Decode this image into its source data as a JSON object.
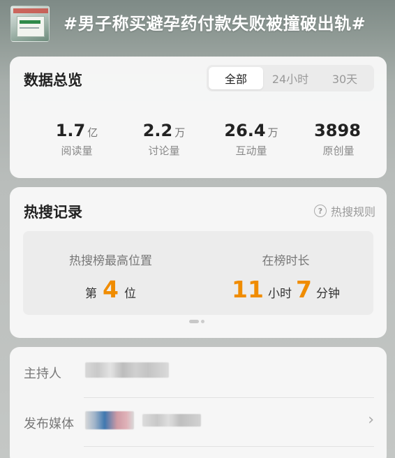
{
  "topic": {
    "title": "#男子称买避孕药付款失败被撞破出轨#",
    "thumbnail_icon": "news-thumbnail-image"
  },
  "overview": {
    "title": "数据总览",
    "tabs": [
      "全部",
      "24小时",
      "30天"
    ],
    "active_tab": "全部",
    "stats": [
      {
        "value": "1.7",
        "unit": "亿",
        "label": "阅读量"
      },
      {
        "value": "2.2",
        "unit": "万",
        "label": "讨论量"
      },
      {
        "value": "26.4",
        "unit": "万",
        "label": "互动量"
      },
      {
        "value": "3898",
        "unit": "",
        "label": "原创量"
      }
    ]
  },
  "hot": {
    "title": "热搜记录",
    "rule_label": "热搜规则",
    "rule_icon": "question-circle-icon",
    "peak": {
      "caption": "热搜榜最高位置",
      "prefix": "第",
      "value": "4",
      "suffix": "位"
    },
    "duration": {
      "caption": "在榜时长",
      "hours": "11",
      "hours_unit": "小时",
      "minutes": "7",
      "minutes_unit": "分钟"
    }
  },
  "info": {
    "host_label": "主持人",
    "media_label": "发布媒体",
    "chevron_icon": "chevron-right-icon"
  },
  "colors": {
    "accent_orange": "#f08c00",
    "title_white": "#ffffff",
    "card_bg": "#f8f8f8"
  }
}
